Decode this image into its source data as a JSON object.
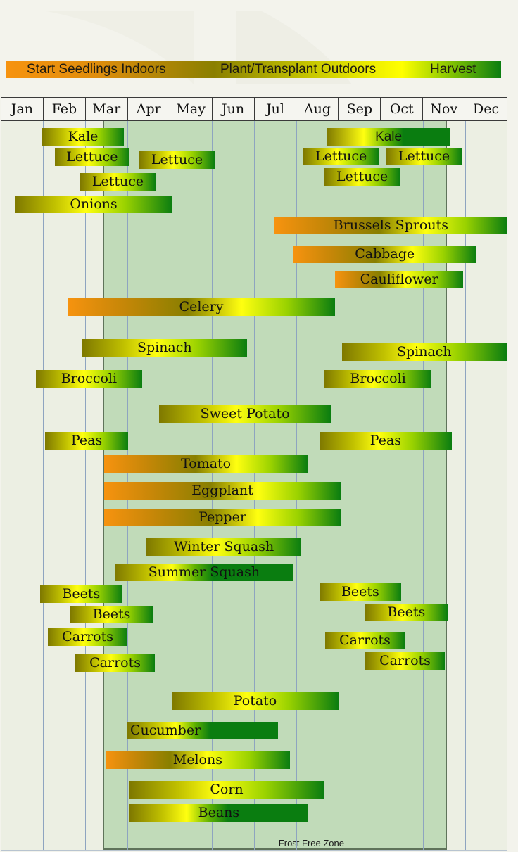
{
  "chart_data": {
    "type": "gantt",
    "title": "",
    "legend": {
      "position": "top",
      "items": [
        "Start Seedlings Indoors",
        "Plant/Transplant Outdoors",
        "Harvest"
      ],
      "colors": {
        "start_indoors": "#f7930f",
        "plant_outdoors": "#ffff10",
        "harvest": "#0a7d10"
      }
    },
    "months": [
      "Jan",
      "Feb",
      "Mar",
      "Apr",
      "May",
      "Jun",
      "Jul",
      "Aug",
      "Sep",
      "Oct",
      "Nov",
      "Dec"
    ],
    "x_range_months": [
      0,
      12
    ],
    "frost_free_zone": {
      "label": "Frost Free Zone",
      "start_month": 2.45,
      "end_month": 10.53
    },
    "crops": [
      {
        "name": "Kale",
        "start": 0.98,
        "end": 2.92,
        "row": 0,
        "style": "green"
      },
      {
        "name": "Kale",
        "start": 7.72,
        "end": 10.65,
        "row": 0,
        "style": "kale",
        "font": "sans"
      },
      {
        "name": "Lettuce",
        "start": 1.28,
        "end": 3.05,
        "row": 1,
        "style": "green"
      },
      {
        "name": "Lettuce",
        "start": 3.28,
        "end": 5.07,
        "row": 1.15,
        "style": "green"
      },
      {
        "name": "Lettuce",
        "start": 7.17,
        "end": 8.95,
        "row": 0.98,
        "style": "green"
      },
      {
        "name": "Lettuce",
        "start": 9.13,
        "end": 10.92,
        "row": 0.98,
        "style": "green"
      },
      {
        "name": "Lettuce",
        "start": 1.88,
        "end": 3.67,
        "row": 2.2,
        "style": "green"
      },
      {
        "name": "Lettuce",
        "start": 7.67,
        "end": 9.45,
        "row": 1.95,
        "style": "green"
      },
      {
        "name": "Onions",
        "start": 0.33,
        "end": 4.07,
        "row": 3.3,
        "style": "green"
      },
      {
        "name": "Brussels Sprouts",
        "start": 6.48,
        "end": 12.0,
        "row": 4.35,
        "style": "orange"
      },
      {
        "name": "Cabbage",
        "start": 6.92,
        "end": 11.27,
        "row": 5.75,
        "style": "orange"
      },
      {
        "name": "Cauliflower",
        "start": 7.92,
        "end": 10.95,
        "row": 7.0,
        "style": "orange-short"
      },
      {
        "name": "Celery",
        "start": 1.58,
        "end": 7.92,
        "row": 8.35,
        "style": "orange"
      },
      {
        "name": "Spinach",
        "start": 1.93,
        "end": 5.83,
        "row": 10.35,
        "style": "green"
      },
      {
        "name": "Spinach",
        "start": 8.08,
        "end": 11.98,
        "row": 10.55,
        "style": "green"
      },
      {
        "name": "Broccoli",
        "start": 0.83,
        "end": 3.35,
        "row": 11.85,
        "style": "green"
      },
      {
        "name": "Broccoli",
        "start": 7.67,
        "end": 10.2,
        "row": 11.85,
        "style": "green"
      },
      {
        "name": "Sweet Potato",
        "start": 3.75,
        "end": 7.82,
        "row": 13.6,
        "style": "green"
      },
      {
        "name": "Peas",
        "start": 1.05,
        "end": 3.02,
        "row": 14.9,
        "style": "green"
      },
      {
        "name": "Peas",
        "start": 7.55,
        "end": 10.68,
        "row": 14.9,
        "style": "green"
      },
      {
        "name": "Tomato",
        "start": 2.45,
        "end": 7.27,
        "row": 16.05,
        "style": "orange"
      },
      {
        "name": "Eggplant",
        "start": 2.45,
        "end": 8.05,
        "row": 17.35,
        "style": "orange"
      },
      {
        "name": "Pepper",
        "start": 2.45,
        "end": 8.05,
        "row": 18.65,
        "style": "orange"
      },
      {
        "name": "Winter Squash",
        "start": 3.45,
        "end": 7.12,
        "row": 20.1,
        "style": "green"
      },
      {
        "name": "Summer Squash",
        "start": 2.7,
        "end": 6.93,
        "row": 21.35,
        "style": "early"
      },
      {
        "name": "Beets",
        "start": 0.93,
        "end": 2.88,
        "row": 22.4,
        "style": "green"
      },
      {
        "name": "Beets",
        "start": 1.65,
        "end": 3.6,
        "row": 23.4,
        "style": "green"
      },
      {
        "name": "Beets",
        "start": 7.55,
        "end": 9.48,
        "row": 22.3,
        "style": "green"
      },
      {
        "name": "Beets",
        "start": 8.63,
        "end": 10.58,
        "row": 23.3,
        "style": "green"
      },
      {
        "name": "Carrots",
        "start": 1.12,
        "end": 3.0,
        "row": 24.5,
        "style": "green"
      },
      {
        "name": "Carrots",
        "start": 1.77,
        "end": 3.65,
        "row": 25.8,
        "style": "green"
      },
      {
        "name": "Carrots",
        "start": 7.68,
        "end": 9.57,
        "row": 24.7,
        "style": "green"
      },
      {
        "name": "Carrots",
        "start": 8.63,
        "end": 10.52,
        "row": 25.7,
        "style": "green"
      },
      {
        "name": "Potato",
        "start": 4.05,
        "end": 8.0,
        "row": 27.65,
        "style": "green"
      },
      {
        "name": "Cucumber",
        "start": 3.0,
        "end": 6.57,
        "row": 29.1,
        "style": "early",
        "align": "left"
      },
      {
        "name": "Melons",
        "start": 2.48,
        "end": 6.85,
        "row": 30.55,
        "style": "orange-short"
      },
      {
        "name": "Corn",
        "start": 3.05,
        "end": 7.65,
        "row": 32.0,
        "style": "green"
      },
      {
        "name": "Beans",
        "start": 3.05,
        "end": 7.28,
        "row": 33.15,
        "style": "early"
      }
    ]
  }
}
